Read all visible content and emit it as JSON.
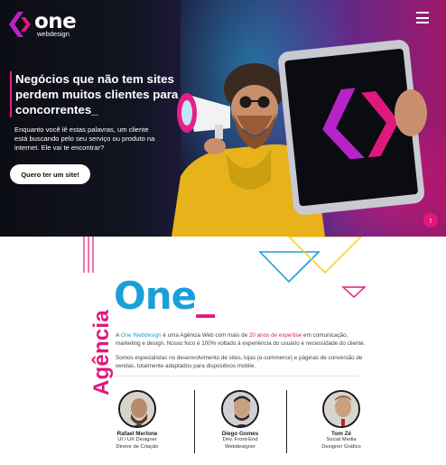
{
  "brand": {
    "name": "one",
    "tagline": "webdesign"
  },
  "hero": {
    "title": "Negócios que não tem sites perdem muitos clientes para concorrentes_",
    "description": "Enquanto você lê estas palavras, um cliente está buscando pelo seu serviço ou produto na internet. Ele vai te encontrar?",
    "cta_label": "Quero ter um site!",
    "scroll_top_icon": "↑"
  },
  "agency": {
    "vertical_title": "Agência",
    "title_main": "One",
    "title_underscore": "_",
    "about_p1_a": "A ",
    "about_p1_brand": "One Webdesign",
    "about_p1_b": " é uma Agência Web com mais de ",
    "about_p1_highlight": "20 anos de expertise",
    "about_p1_c": " em comunicação, marketing e design. Nosso foco é 100% voltado à experiência do usuário e necessidade do cliente.",
    "about_p2": "Somos especialistas no desenvolvimento de sites, lojas (e-commerce) e páginas de conversão de vendas, totalmente adaptados para dispositivos mobile."
  },
  "team": [
    {
      "name": "Rafael Merlone",
      "role1": "UI / UX Designer",
      "role2": "Diretor de Criação"
    },
    {
      "name": "Diego Gomes",
      "role1": "Dev. Front-End",
      "role2": "Webdesigner"
    },
    {
      "name": "Tom Zé",
      "role1": "Social Media",
      "role2": "Designer Gráfico"
    }
  ],
  "colors": {
    "accent_pink": "#e0187c",
    "accent_blue": "#1aa0d8",
    "hero_dark": "#121421"
  }
}
